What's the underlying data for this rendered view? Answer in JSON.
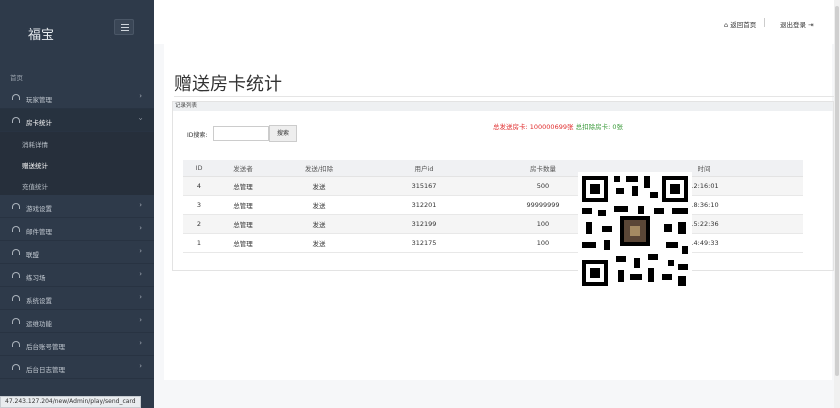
{
  "sidebar": {
    "brand": "福宝",
    "section": "首页",
    "menu": [
      {
        "label": "玩家管理"
      },
      {
        "label": "房卡统计"
      },
      {
        "label": "游戏设置"
      },
      {
        "label": "邮件管理"
      },
      {
        "label": "联盟"
      },
      {
        "label": "练习场"
      },
      {
        "label": "系统设置"
      },
      {
        "label": "运维功能"
      },
      {
        "label": "后台账号管理"
      },
      {
        "label": "后台日志管理"
      }
    ],
    "submenu": [
      {
        "label": "消耗详情"
      },
      {
        "label": "赠送统计"
      },
      {
        "label": "充值统计"
      }
    ]
  },
  "topbar": {
    "home": "返回首页",
    "logout": "退出登录"
  },
  "page": {
    "title": "赠送房卡统计",
    "panel_title": "记录列表",
    "search_label": "ID搜索:",
    "search_button": "搜索",
    "stats_total": "总发送房卡: 100000699张",
    "stats_deduct": "总扣除房卡: 0张"
  },
  "table": {
    "headers": [
      "ID",
      "发送者",
      "发送/扣除",
      "用户id",
      "房卡数量",
      "时间"
    ],
    "rows": [
      [
        "4",
        "总管理",
        "发送",
        "315167",
        "500",
        "12:16:01"
      ],
      [
        "3",
        "总管理",
        "发送",
        "312201",
        "99999999",
        "18:36:10"
      ],
      [
        "2",
        "总管理",
        "发送",
        "312199",
        "100",
        "15:22:36"
      ],
      [
        "1",
        "总管理",
        "发送",
        "312175",
        "100",
        "14:49:33"
      ]
    ]
  },
  "statusbar": {
    "url": "47.243.127.204/new/Admin/play/send_card"
  }
}
